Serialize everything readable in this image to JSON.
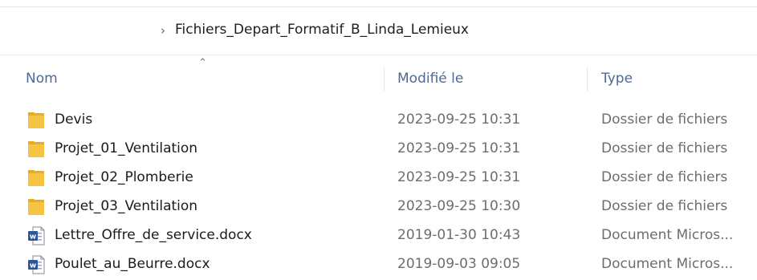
{
  "breadcrumb": {
    "path": "Fichiers_Depart_Formatif_B_Linda_Lemieux"
  },
  "columns": {
    "name": "Nom",
    "modified": "Modifié le",
    "type": "Type"
  },
  "files": [
    {
      "icon": "folder-icon",
      "name": "Devis",
      "modified": "2023-09-25 10:31",
      "type": "Dossier de fichiers"
    },
    {
      "icon": "folder-icon",
      "name": "Projet_01_Ventilation",
      "modified": "2023-09-25 10:31",
      "type": "Dossier de fichiers"
    },
    {
      "icon": "folder-icon",
      "name": "Projet_02_Plomberie",
      "modified": "2023-09-25 10:31",
      "type": "Dossier de fichiers"
    },
    {
      "icon": "folder-icon",
      "name": "Projet_03_Ventilation",
      "modified": "2023-09-25 10:30",
      "type": "Dossier de fichiers"
    },
    {
      "icon": "word-document-icon",
      "name": "Lettre_Offre_de_service.docx",
      "modified": "2019-01-30 10:43",
      "type": "Document Micros..."
    },
    {
      "icon": "word-document-icon",
      "name": "Poulet_au_Beurre.docx",
      "modified": "2019-09-03 09:05",
      "type": "Document Micros..."
    }
  ],
  "colors": {
    "header_text": "#4d6a94",
    "folder": "#f6c444",
    "word_blue": "#2b579a"
  }
}
